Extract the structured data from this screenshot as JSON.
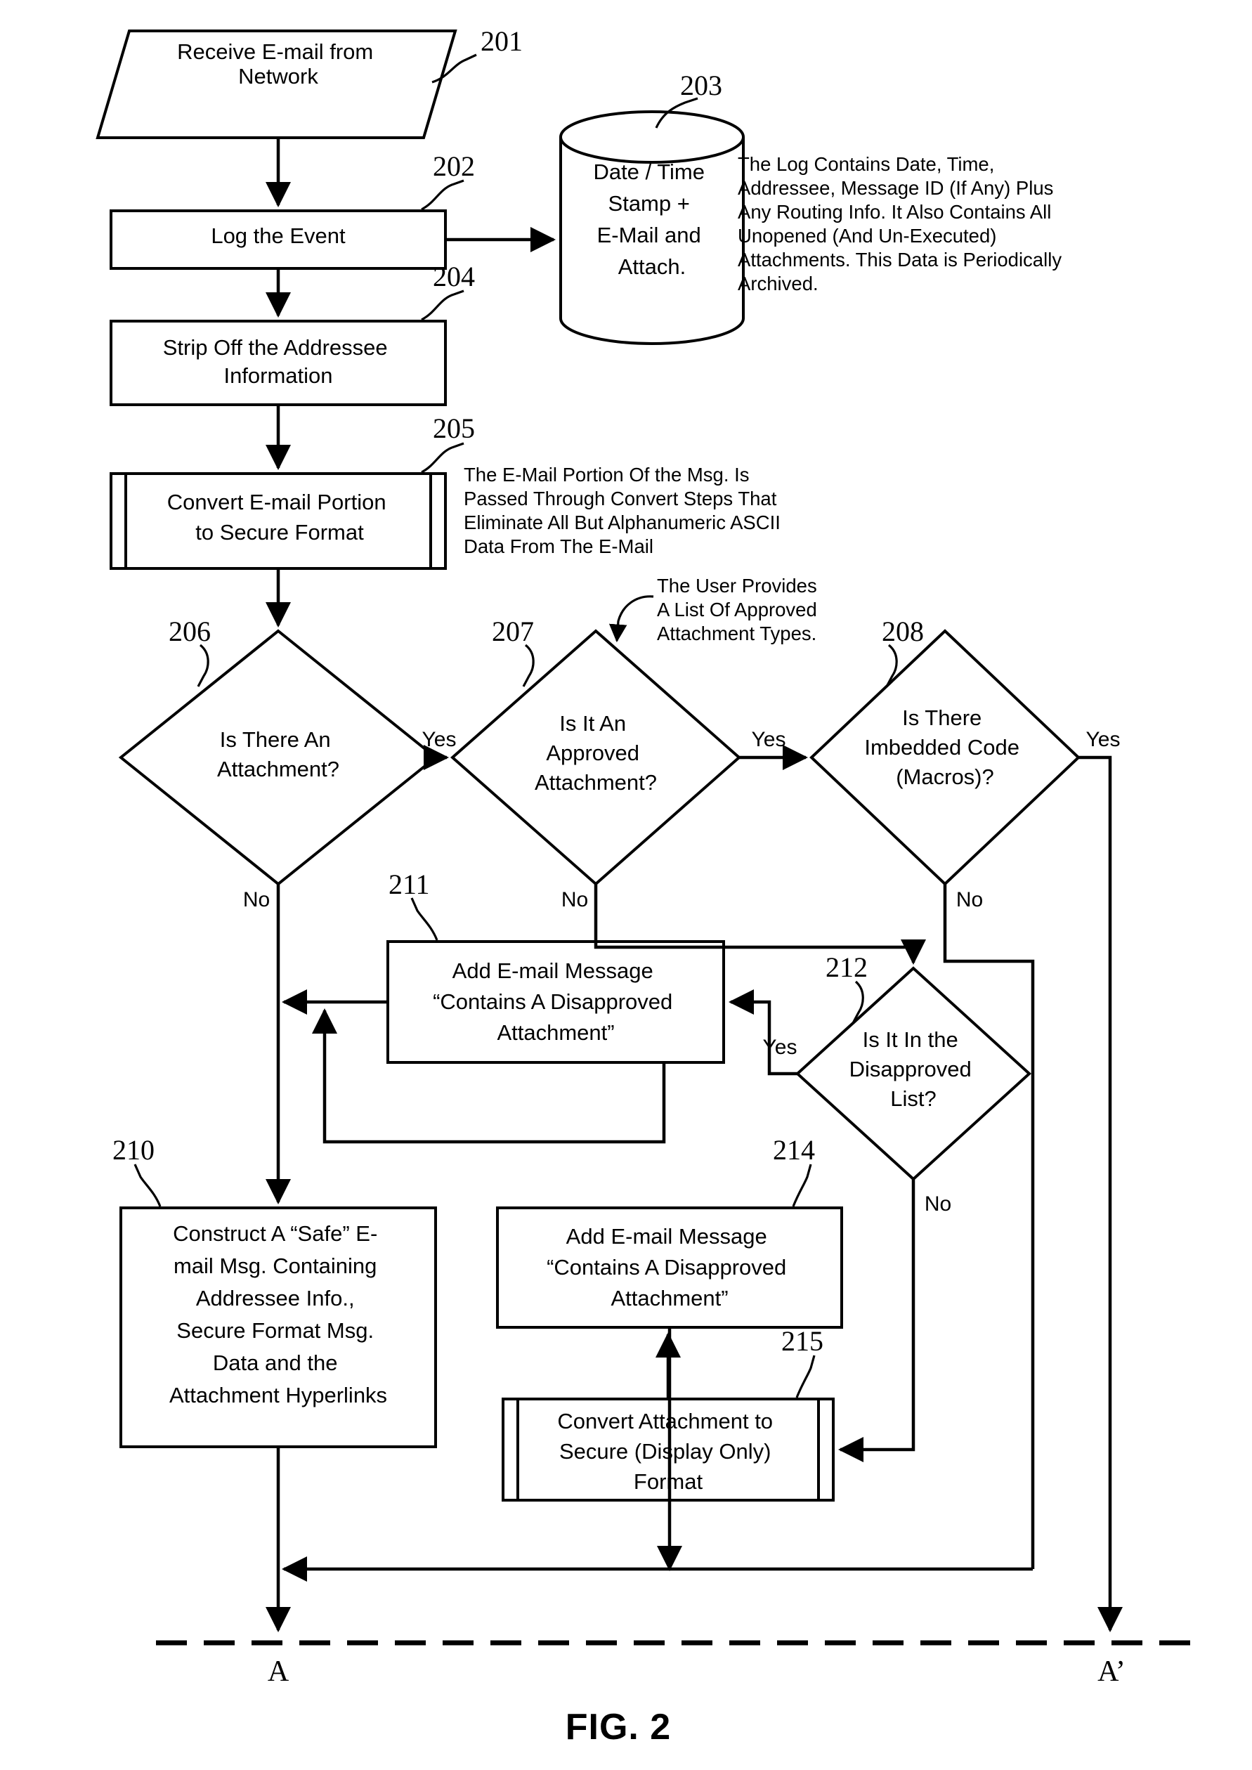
{
  "figure": {
    "caption": "FIG. 2",
    "title": "E-mail Security Processing Flowchart"
  },
  "nodes": [
    {
      "ref": "201",
      "shape": "parallelogram",
      "lines": [
        "Receive E-mail from",
        "Network"
      ]
    },
    {
      "ref": "202",
      "shape": "process",
      "lines": [
        "Log the Event"
      ]
    },
    {
      "ref": "203",
      "shape": "cylinder",
      "lines": [
        "Date / Time",
        "Stamp +",
        "E-Mail and",
        "Attach."
      ]
    },
    {
      "ref": "204",
      "shape": "process",
      "lines": [
        "Strip Off the Addressee",
        "Information"
      ]
    },
    {
      "ref": "205",
      "shape": "predefined-process",
      "lines": [
        "Convert E-mail Portion",
        "to Secure Format"
      ]
    },
    {
      "ref": "206",
      "shape": "decision",
      "lines": [
        "Is There An",
        "Attachment?"
      ]
    },
    {
      "ref": "207",
      "shape": "decision",
      "lines": [
        "Is It An",
        "Approved",
        "Attachment?"
      ]
    },
    {
      "ref": "208",
      "shape": "decision",
      "lines": [
        "Is There",
        "Imbedded Code",
        "(Macros)?"
      ]
    },
    {
      "ref": "210",
      "shape": "process",
      "lines": [
        "Construct A “Safe” E-",
        "mail Msg. Containing",
        "Addressee Info.,",
        "Secure Format Msg.",
        "Data and the",
        "Attachment Hyperlinks"
      ]
    },
    {
      "ref": "211",
      "shape": "process",
      "lines": [
        "Add E-mail Message",
        "“Contains A Disapproved",
        "Attachment”"
      ]
    },
    {
      "ref": "212",
      "shape": "decision",
      "lines": [
        "Is It In the",
        "Disapproved",
        "List?"
      ]
    },
    {
      "ref": "214",
      "shape": "process",
      "lines": [
        "Add E-mail Message",
        "“Contains A Disapproved",
        "Attachment”"
      ]
    },
    {
      "ref": "215",
      "shape": "predefined-process",
      "lines": [
        "Convert Attachment to",
        "Secure (Display Only)",
        "Format"
      ]
    }
  ],
  "notes": [
    {
      "id": "log-note",
      "lines": [
        "The Log Contains Date, Time,",
        "Addressee, Message ID (If Any) Plus",
        "Any Routing Info. It Also Contains All",
        "Unopened (And Un-Executed)",
        "Attachments.  This Data is Periodically",
        "Archived."
      ]
    },
    {
      "id": "convert-note",
      "lines": [
        "The E-Mail Portion Of the Msg. Is",
        "Passed Through Convert Steps That",
        "Eliminate All But Alphanumeric ASCII",
        "Data From The E-Mail"
      ]
    },
    {
      "id": "approved-list-note",
      "lines": [
        "The User Provides",
        "A List Of Approved",
        "Attachment Types."
      ]
    }
  ],
  "branch_labels": {
    "yes_206_to_207": "Yes",
    "no_206": "No",
    "yes_207_to_208": "Yes",
    "no_207": "No",
    "yes_208": "Yes",
    "no_208": "No",
    "yes_212": "Yes",
    "no_212": "No"
  },
  "connectors": {
    "left_endpoint": "A",
    "right_endpoint": "A’"
  },
  "colors": {
    "ink": "#000000",
    "paper": "#ffffff"
  }
}
